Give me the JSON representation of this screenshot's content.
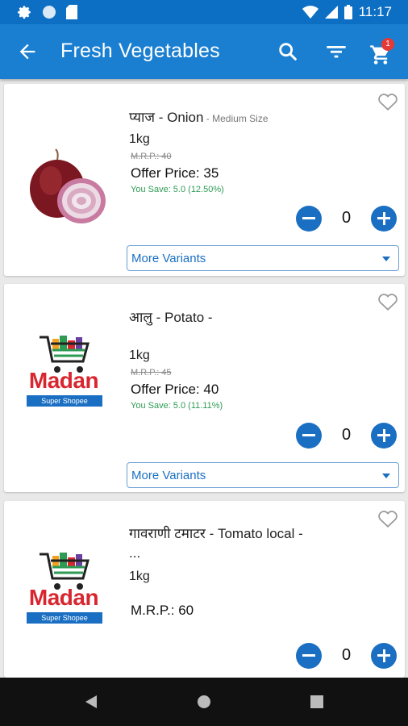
{
  "status_bar": {
    "time": "11:17"
  },
  "app_bar": {
    "title": "Fresh Vegetables",
    "cart_count": "1"
  },
  "products": [
    {
      "name": "प्याज - Onion",
      "name_suffix": " - Medium Size",
      "unit": "1kg",
      "mrp": "M.R.P.: 40",
      "offer": "Offer Price: 35",
      "save": "You Save: 5.0 (12.50%)",
      "qty": "0",
      "variants_label": "More Variants"
    },
    {
      "name": "आलु - Potato -",
      "unit": "1kg",
      "mrp": "M.R.P.: 45",
      "offer": "Offer Price: 40",
      "save": "You Save: 5.0 (11.11%)",
      "qty": "0",
      "variants_label": "More Variants",
      "logo_word": "Madan",
      "logo_tag": "Super Shopee"
    },
    {
      "name": "गावराणी टमाटर - Tomato local -",
      "name_line2": "...",
      "unit": "1kg",
      "mrp": "M.R.P.: 60",
      "qty": "0",
      "logo_word": "Madan",
      "logo_tag": "Super Shopee"
    }
  ],
  "icons": {
    "back": "arrow-left-icon",
    "search": "search-icon",
    "filter": "filter-icon",
    "cart": "cart-icon",
    "favorite": "heart-outline-icon"
  },
  "colors": {
    "primary": "#1a7fd1",
    "status_bar": "#0d6fc3",
    "qty_button": "#1a6fc3",
    "save_text": "#2e9b55",
    "logo_red": "#d8262f",
    "badge": "#e53935"
  }
}
